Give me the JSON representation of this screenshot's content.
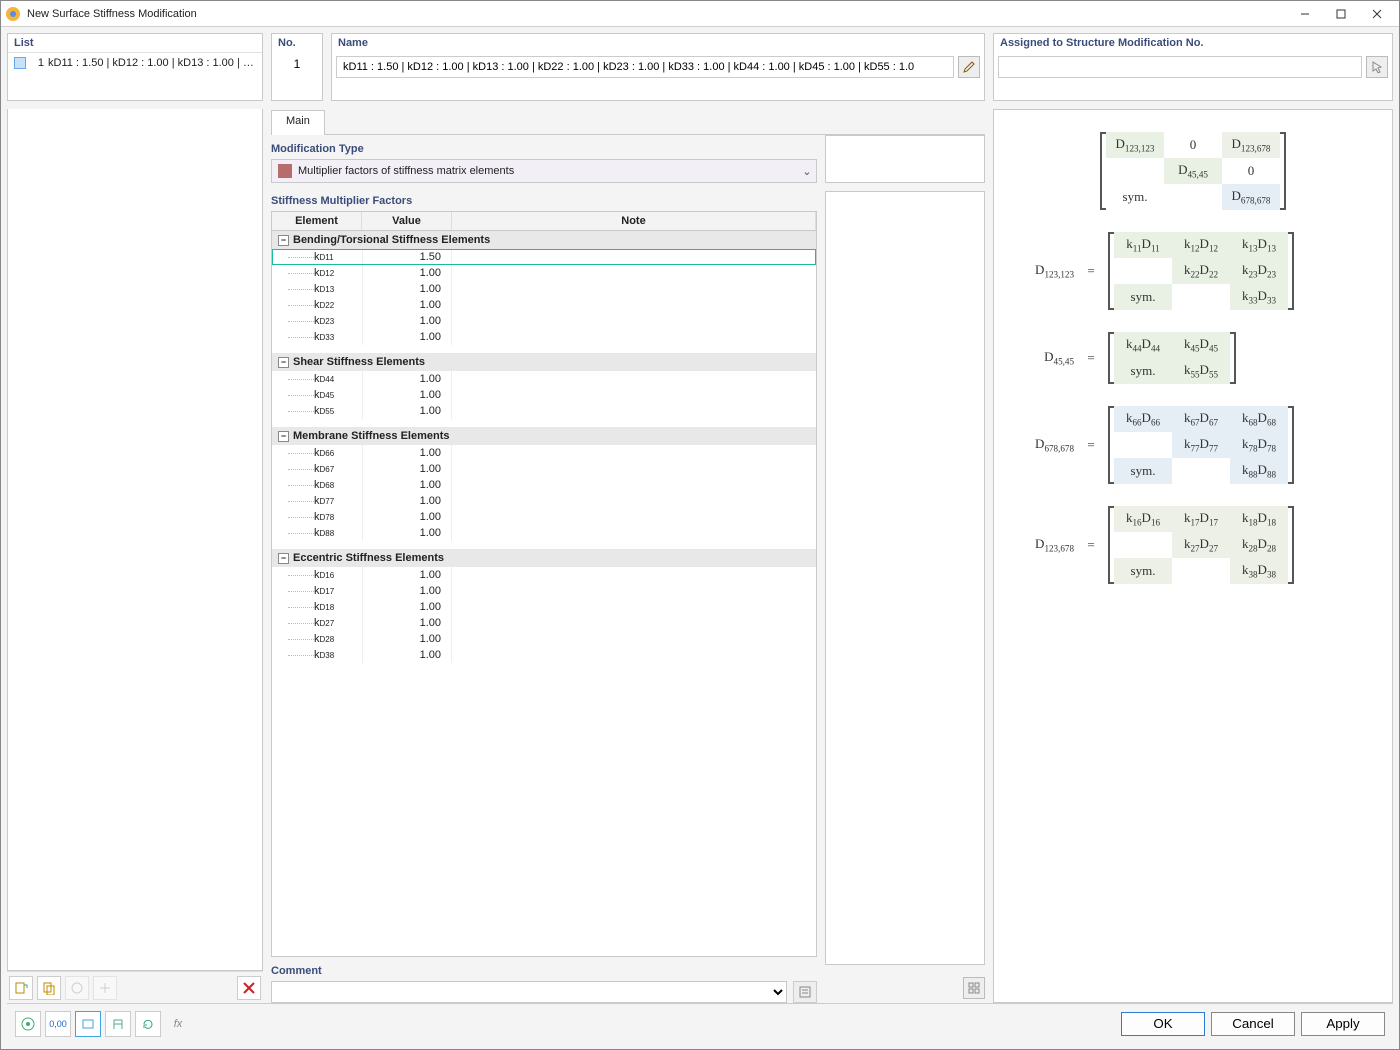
{
  "window": {
    "title": "New Surface Stiffness Modification"
  },
  "list": {
    "header": "List",
    "items": [
      {
        "num": "1",
        "text": "kD11 : 1.50 | kD12 : 1.00 | kD13 : 1.00 | kD22 : 1.00 |"
      }
    ]
  },
  "no": {
    "header": "No.",
    "value": "1"
  },
  "name": {
    "header": "Name",
    "value": "kD11 : 1.50 | kD12 : 1.00 | kD13 : 1.00 | kD22 : 1.00 | kD23 : 1.00 | kD33 : 1.00 | kD44 : 1.00 | kD45 : 1.00 | kD55 : 1.0"
  },
  "assigned": {
    "header": "Assigned to Structure Modification No.",
    "value": ""
  },
  "tabs": {
    "main": "Main"
  },
  "modtype": {
    "label": "Modification Type",
    "value": "Multiplier factors of stiffness matrix elements"
  },
  "smf": {
    "label": "Stiffness Multiplier Factors",
    "cols": {
      "element": "Element",
      "value": "Value",
      "note": "Note"
    },
    "groups": [
      {
        "title": "Bending/Torsional Stiffness Elements",
        "rows": [
          {
            "k": "kD11",
            "sub": "D11",
            "val": "1.50",
            "sel": true
          },
          {
            "k": "kD12",
            "sub": "D12",
            "val": "1.00"
          },
          {
            "k": "kD13",
            "sub": "D13",
            "val": "1.00"
          },
          {
            "k": "kD22",
            "sub": "D22",
            "val": "1.00"
          },
          {
            "k": "kD23",
            "sub": "D23",
            "val": "1.00"
          },
          {
            "k": "kD33",
            "sub": "D33",
            "val": "1.00"
          }
        ]
      },
      {
        "title": "Shear Stiffness Elements",
        "rows": [
          {
            "k": "kD44",
            "sub": "D44",
            "val": "1.00"
          },
          {
            "k": "kD45",
            "sub": "D45",
            "val": "1.00"
          },
          {
            "k": "kD55",
            "sub": "D55",
            "val": "1.00"
          }
        ]
      },
      {
        "title": "Membrane Stiffness Elements",
        "rows": [
          {
            "k": "kD66",
            "sub": "D66",
            "val": "1.00"
          },
          {
            "k": "kD67",
            "sub": "D67",
            "val": "1.00"
          },
          {
            "k": "kD68",
            "sub": "D68",
            "val": "1.00"
          },
          {
            "k": "kD77",
            "sub": "D77",
            "val": "1.00"
          },
          {
            "k": "kD78",
            "sub": "D78",
            "val": "1.00"
          },
          {
            "k": "kD88",
            "sub": "D88",
            "val": "1.00"
          }
        ]
      },
      {
        "title": "Eccentric Stiffness Elements",
        "rows": [
          {
            "k": "kD16",
            "sub": "D16",
            "val": "1.00"
          },
          {
            "k": "kD17",
            "sub": "D17",
            "val": "1.00"
          },
          {
            "k": "kD18",
            "sub": "D18",
            "val": "1.00"
          },
          {
            "k": "kD27",
            "sub": "D27",
            "val": "1.00"
          },
          {
            "k": "kD28",
            "sub": "D28",
            "val": "1.00"
          },
          {
            "k": "kD38",
            "sub": "D38",
            "val": "1.00"
          }
        ]
      }
    ]
  },
  "matrices": {
    "overview": {
      "cols": 3,
      "cells": [
        {
          "t": "D",
          "s": "123,123",
          "c": "cell-g1"
        },
        {
          "t": "0",
          "c": "cell-0"
        },
        {
          "t": "D",
          "s": "123,678",
          "c": "cell-g2"
        },
        {
          "t": ""
        },
        {
          "t": "D",
          "s": "45,45",
          "c": "cell-g1"
        },
        {
          "t": "0",
          "c": "cell-0"
        },
        {
          "t": "sym."
        },
        {
          "t": ""
        },
        {
          "t": "D",
          "s": "678,678",
          "c": "cell-b"
        }
      ]
    },
    "eqs": [
      {
        "lhs": "D",
        "lsub": "123,123",
        "cols": 3,
        "cells": [
          {
            "t": "k",
            "s": "11",
            "t2": "D",
            "s2": "11",
            "c": "cell-g1"
          },
          {
            "t": "k",
            "s": "12",
            "t2": "D",
            "s2": "12",
            "c": "cell-g1"
          },
          {
            "t": "k",
            "s": "13",
            "t2": "D",
            "s2": "13",
            "c": "cell-g1"
          },
          {
            "t": ""
          },
          {
            "t": "k",
            "s": "22",
            "t2": "D",
            "s2": "22",
            "c": "cell-g1"
          },
          {
            "t": "k",
            "s": "23",
            "t2": "D",
            "s2": "23",
            "c": "cell-g1"
          },
          {
            "t": "sym.",
            "c": "cell-g1"
          },
          {
            "t": ""
          },
          {
            "t": "k",
            "s": "33",
            "t2": "D",
            "s2": "33",
            "c": "cell-g1"
          }
        ]
      },
      {
        "lhs": "D",
        "lsub": "45,45",
        "cols": 2,
        "cells": [
          {
            "t": "k",
            "s": "44",
            "t2": "D",
            "s2": "44",
            "c": "cell-g1"
          },
          {
            "t": "k",
            "s": "45",
            "t2": "D",
            "s2": "45",
            "c": "cell-g1"
          },
          {
            "t": "sym.",
            "c": "cell-g1"
          },
          {
            "t": "k",
            "s": "55",
            "t2": "D",
            "s2": "55",
            "c": "cell-g1"
          }
        ]
      },
      {
        "lhs": "D",
        "lsub": "678,678",
        "cols": 3,
        "cells": [
          {
            "t": "k",
            "s": "66",
            "t2": "D",
            "s2": "66",
            "c": "cell-b"
          },
          {
            "t": "k",
            "s": "67",
            "t2": "D",
            "s2": "67",
            "c": "cell-b"
          },
          {
            "t": "k",
            "s": "68",
            "t2": "D",
            "s2": "68",
            "c": "cell-b"
          },
          {
            "t": ""
          },
          {
            "t": "k",
            "s": "77",
            "t2": "D",
            "s2": "77",
            "c": "cell-b"
          },
          {
            "t": "k",
            "s": "78",
            "t2": "D",
            "s2": "78",
            "c": "cell-b"
          },
          {
            "t": "sym.",
            "c": "cell-b"
          },
          {
            "t": ""
          },
          {
            "t": "k",
            "s": "88",
            "t2": "D",
            "s2": "88",
            "c": "cell-b"
          }
        ]
      },
      {
        "lhs": "D",
        "lsub": "123,678",
        "cols": 3,
        "cells": [
          {
            "t": "k",
            "s": "16",
            "t2": "D",
            "s2": "16",
            "c": "cell-g2"
          },
          {
            "t": "k",
            "s": "17",
            "t2": "D",
            "s2": "17",
            "c": "cell-g2"
          },
          {
            "t": "k",
            "s": "18",
            "t2": "D",
            "s2": "18",
            "c": "cell-g2"
          },
          {
            "t": ""
          },
          {
            "t": "k",
            "s": "27",
            "t2": "D",
            "s2": "27",
            "c": "cell-g2"
          },
          {
            "t": "k",
            "s": "28",
            "t2": "D",
            "s2": "28",
            "c": "cell-g2"
          },
          {
            "t": "sym.",
            "c": "cell-g2"
          },
          {
            "t": ""
          },
          {
            "t": "k",
            "s": "38",
            "t2": "D",
            "s2": "38",
            "c": "cell-g2"
          }
        ]
      }
    ]
  },
  "comment": {
    "label": "Comment",
    "value": ""
  },
  "buttons": {
    "ok": "OK",
    "cancel": "Cancel",
    "apply": "Apply"
  }
}
